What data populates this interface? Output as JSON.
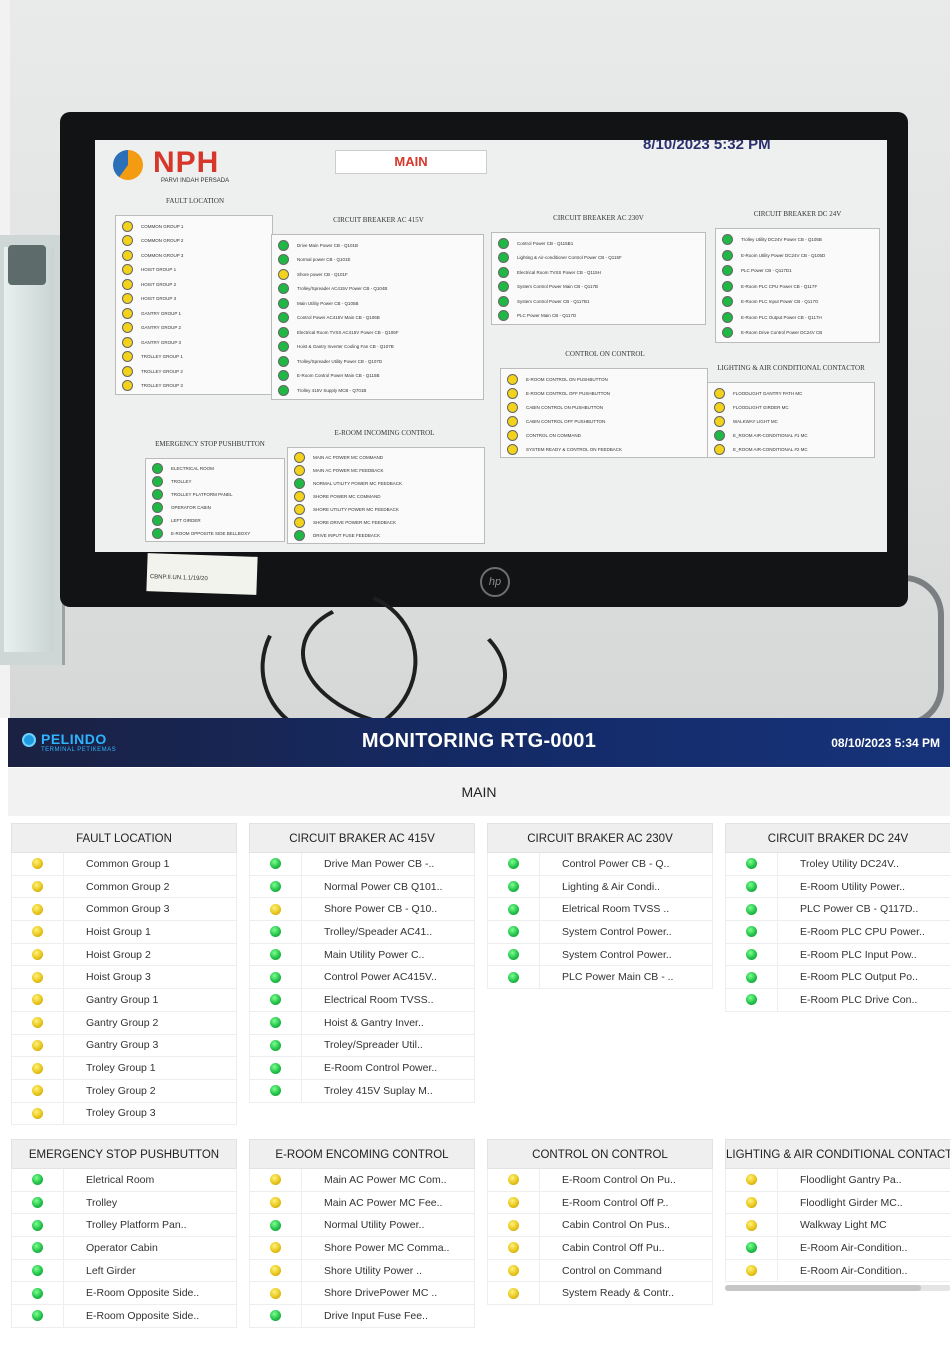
{
  "photo": {
    "screen": {
      "logo_text": "NPH",
      "logo_sub": "PARVI INDAH PERSADA",
      "main_label": "MAIN",
      "datetime": "8/10/2023 5:32 PM",
      "sections": [
        {
          "title": "FAULT LOCATION",
          "items": [
            {
              "status": "yellow",
              "label": "COMMON GROUP 1"
            },
            {
              "status": "yellow",
              "label": "COMMON GROUP 2"
            },
            {
              "status": "yellow",
              "label": "COMMON GROUP 3"
            },
            {
              "status": "yellow",
              "label": "HOIST GROUP 1"
            },
            {
              "status": "yellow",
              "label": "HOIST GROUP 2"
            },
            {
              "status": "yellow",
              "label": "HOIST GROUP 3"
            },
            {
              "status": "yellow",
              "label": "GANTRY GROUP 1"
            },
            {
              "status": "yellow",
              "label": "GANTRY GROUP 2"
            },
            {
              "status": "yellow",
              "label": "GANTRY GROUP 3"
            },
            {
              "status": "yellow",
              "label": "TROLLEY GROUP 1"
            },
            {
              "status": "yellow",
              "label": "TROLLEY GROUP 2"
            },
            {
              "status": "yellow",
              "label": "TROLLEY GROUP 3"
            }
          ]
        },
        {
          "title": "CIRCUIT BREAKER AC 415V",
          "items": [
            {
              "status": "green",
              "label": "Drive Main Power CB - Q101B"
            },
            {
              "status": "green",
              "label": "Normal power CB - Q101E"
            },
            {
              "status": "yellow",
              "label": "Shore power CB - Q101F"
            },
            {
              "status": "green",
              "label": "Trolley/Spreader AC415V Power CB - Q104B"
            },
            {
              "status": "green",
              "label": "Main Utility Power CB - Q105B"
            },
            {
              "status": "green",
              "label": "Control Power AC415V Main CB - Q106B"
            },
            {
              "status": "green",
              "label": "Electrical Room TVSS AC415V Power CB - Q106F"
            },
            {
              "status": "green",
              "label": "Hoist & Gantry Inverter Cooling Fan CB - Q107B"
            },
            {
              "status": "green",
              "label": "Trolley/Spreader Utility Power CB - Q107D"
            },
            {
              "status": "green",
              "label": "E-Room Control Power Main CB - Q115B"
            },
            {
              "status": "green",
              "label": "Trolley 415V Supply MCB - Q701B"
            }
          ]
        },
        {
          "title": "CIRCUIT BREAKER AC 230V",
          "items": [
            {
              "status": "green",
              "label": "Control Power CB - Q115B1"
            },
            {
              "status": "green",
              "label": "Lighting & Air-conditioner Control Power CB - Q115F"
            },
            {
              "status": "green",
              "label": "Electrical Room TVSS Power CB - Q115H"
            },
            {
              "status": "green",
              "label": "System Control Power Main CB - Q117B"
            },
            {
              "status": "green",
              "label": "System Control Power CB - Q117B1"
            },
            {
              "status": "green",
              "label": "PLC Power Main CB - Q117D"
            }
          ]
        },
        {
          "title": "CIRCUIT BREAKER DC 24V",
          "items": [
            {
              "status": "green",
              "label": "Trolley Utility DC24V Power CB - Q105B"
            },
            {
              "status": "green",
              "label": "E-Room Utility Power DC24V CB - Q105D"
            },
            {
              "status": "green",
              "label": "PLC Power CB - Q117D1"
            },
            {
              "status": "green",
              "label": "E-Room PLC CPU Power CB - Q117F"
            },
            {
              "status": "green",
              "label": "E-Room PLC Input Power CB - Q117G"
            },
            {
              "status": "green",
              "label": "E-Room PLC Output Power CB - Q117H"
            },
            {
              "status": "green",
              "label": "E-Room Drive Control Power DC24V CB"
            }
          ]
        },
        {
          "title": "EMERGENCY STOP PUSHBUTTON",
          "items": [
            {
              "status": "green",
              "label": "ELECTRICAL ROOM"
            },
            {
              "status": "green",
              "label": "TROLLEY"
            },
            {
              "status": "green",
              "label": "TROLLEY PLATFORM PANEL"
            },
            {
              "status": "green",
              "label": "OPERATOR CABIN"
            },
            {
              "status": "green",
              "label": "LEFT GIRDER"
            },
            {
              "status": "green",
              "label": "E-ROOM OPPOSITE SIDE BELLBOXY"
            }
          ]
        },
        {
          "title": "E-ROOM INCOMING CONTROL",
          "items": [
            {
              "status": "yellow",
              "label": "MAIN AC POWER MC COMMAND"
            },
            {
              "status": "yellow",
              "label": "MAIN AC POWER MC FEEDBACK"
            },
            {
              "status": "green",
              "label": "NORMAL UTILITY POWER MC FEEDBACK"
            },
            {
              "status": "yellow",
              "label": "SHORE POWER MC COMMAND"
            },
            {
              "status": "yellow",
              "label": "SHORE UTILITY POWER MC FEEDBACK"
            },
            {
              "status": "yellow",
              "label": "SHORE DRIVE POWER MC FEEDBACK"
            },
            {
              "status": "green",
              "label": "DRIVE INPUT FUSE FEEDBACK"
            }
          ]
        },
        {
          "title": "CONTROL ON CONTROL",
          "items": [
            {
              "status": "yellow",
              "label": "E-ROOM CONTROL ON PUSHBUTTON"
            },
            {
              "status": "yellow",
              "label": "E-ROOM CONTROL OFF PUSHBUTTON"
            },
            {
              "status": "yellow",
              "label": "CABIN CONTROL ON PUSHBUTTON"
            },
            {
              "status": "yellow",
              "label": "CABIN CONTROL OFF PUSHBUTTON"
            },
            {
              "status": "yellow",
              "label": "CONTROL ON COMMAND"
            },
            {
              "status": "yellow",
              "label": "SYSTEM READY & CONTROL ON FEEDBACK"
            }
          ]
        },
        {
          "title": "LIGHTING & AIR CONDITIONAL CONTACTOR",
          "items": [
            {
              "status": "yellow",
              "label": "FLOODLIGHT GANTRY PATH MC"
            },
            {
              "status": "yellow",
              "label": "FLOODLIGHT GIRDER MC"
            },
            {
              "status": "yellow",
              "label": "WALKWAY LIGHT MC"
            },
            {
              "status": "green",
              "label": "E_ROOM AIR-CONDITIONAL #1 MC"
            },
            {
              "status": "yellow",
              "label": "E_ROOM AIR-CONDITIONAL #2 MC"
            }
          ]
        }
      ]
    },
    "sticker_text": "CBNP.II.UN.1.1/19/20"
  },
  "app": {
    "brand": {
      "name": "PELINDO",
      "sub": "TERMINAL PETIKEMAS"
    },
    "title": "MONITORING RTG-0001",
    "datetime": "08/10/2023 5:34 PM",
    "section_title": "MAIN",
    "status_colors": {
      "yellow": "#e8c51b",
      "green": "#22c24a"
    },
    "panels": [
      {
        "title": "FAULT LOCATION",
        "items": [
          {
            "status": "yellow",
            "label": "Common Group 1"
          },
          {
            "status": "yellow",
            "label": "Common Group 2"
          },
          {
            "status": "yellow",
            "label": "Common Group 3"
          },
          {
            "status": "yellow",
            "label": "Hoist Group 1"
          },
          {
            "status": "yellow",
            "label": "Hoist Group 2"
          },
          {
            "status": "yellow",
            "label": "Hoist Group 3"
          },
          {
            "status": "yellow",
            "label": "Gantry Group 1"
          },
          {
            "status": "yellow",
            "label": "Gantry Group 2"
          },
          {
            "status": "yellow",
            "label": "Gantry Group 3"
          },
          {
            "status": "yellow",
            "label": "Troley Group 1"
          },
          {
            "status": "yellow",
            "label": "Troley Group 2"
          },
          {
            "status": "yellow",
            "label": "Troley Group 3"
          }
        ]
      },
      {
        "title": "CIRCUIT BRAKER AC 415V",
        "items": [
          {
            "status": "green",
            "label": "Drive Man Power CB -.."
          },
          {
            "status": "green",
            "label": "Normal Power CB Q101.."
          },
          {
            "status": "yellow",
            "label": "Shore Power CB - Q10.."
          },
          {
            "status": "green",
            "label": "Trolley/Speader AC41.."
          },
          {
            "status": "green",
            "label": "Main Utility Power C.."
          },
          {
            "status": "green",
            "label": "Control Power AC415V.."
          },
          {
            "status": "green",
            "label": "Electrical Room TVSS.."
          },
          {
            "status": "green",
            "label": "Hoist & Gantry Inver.."
          },
          {
            "status": "green",
            "label": "Troley/Spreader Util.."
          },
          {
            "status": "green",
            "label": "E-Room Control Power.."
          },
          {
            "status": "green",
            "label": "Troley 415V Suplay M.."
          }
        ]
      },
      {
        "title": "CIRCUIT BRAKER AC 230V",
        "items": [
          {
            "status": "green",
            "label": "Control Power CB - Q.."
          },
          {
            "status": "green",
            "label": "Lighting & Air Condi.."
          },
          {
            "status": "green",
            "label": "Eletrical Room TVSS .."
          },
          {
            "status": "green",
            "label": "System Control Power.."
          },
          {
            "status": "green",
            "label": "System Control Power.."
          },
          {
            "status": "green",
            "label": "PLC Power Main CB - .."
          }
        ]
      },
      {
        "title": "CIRCUIT BRAKER DC 24V",
        "items": [
          {
            "status": "green",
            "label": "Troley Utility DC24V.."
          },
          {
            "status": "green",
            "label": "E-Room Utility Power.."
          },
          {
            "status": "green",
            "label": "PLC Power CB - Q117D.."
          },
          {
            "status": "green",
            "label": "E-Room PLC CPU Power.."
          },
          {
            "status": "green",
            "label": "E-Room PLC Input Pow.."
          },
          {
            "status": "green",
            "label": "E-Room PLC Output Po.."
          },
          {
            "status": "green",
            "label": "E-Room PLC Drive Con.."
          }
        ]
      },
      {
        "title": "EMERGENCY STOP PUSHBUTTON",
        "items": [
          {
            "status": "green",
            "label": "Eletrical Room"
          },
          {
            "status": "green",
            "label": "Trolley"
          },
          {
            "status": "green",
            "label": "Trolley Platform Pan.."
          },
          {
            "status": "green",
            "label": "Operator Cabin"
          },
          {
            "status": "green",
            "label": "Left Girder"
          },
          {
            "status": "green",
            "label": "E-Room Opposite Side.."
          },
          {
            "status": "green",
            "label": "E-Room Opposite Side.."
          }
        ]
      },
      {
        "title": "E-ROOM ENCOMING CONTROL",
        "items": [
          {
            "status": "yellow",
            "label": "Main AC Power MC Com.."
          },
          {
            "status": "yellow",
            "label": "Main AC Power MC Fee.."
          },
          {
            "status": "green",
            "label": "Normal Utility Power.."
          },
          {
            "status": "yellow",
            "label": "Shore Power MC Comma.."
          },
          {
            "status": "yellow",
            "label": "Shore Utility Power .."
          },
          {
            "status": "yellow",
            "label": "Shore DrivePower MC .."
          },
          {
            "status": "green",
            "label": "Drive Input Fuse Fee.."
          }
        ]
      },
      {
        "title": "CONTROL ON CONTROL",
        "items": [
          {
            "status": "yellow",
            "label": "E-Room Control On Pu.."
          },
          {
            "status": "yellow",
            "label": "E-Room Control Off P.."
          },
          {
            "status": "yellow",
            "label": "Cabin Control On Pus.."
          },
          {
            "status": "yellow",
            "label": "Cabin Control Off Pu.."
          },
          {
            "status": "yellow",
            "label": "Control on Command"
          },
          {
            "status": "yellow",
            "label": "System Ready & Contr.."
          }
        ]
      },
      {
        "title": "LIGHTING & AIR CONDITIONAL CONTACTOR",
        "items": [
          {
            "status": "yellow",
            "label": "Floodlight Gantry Pa.."
          },
          {
            "status": "yellow",
            "label": "Floodlight Girder MC.."
          },
          {
            "status": "yellow",
            "label": "Walkway Light MC"
          },
          {
            "status": "green",
            "label": "E-Room Air-Condition.."
          },
          {
            "status": "yellow",
            "label": "E-Room Air-Condition.."
          }
        ]
      }
    ]
  }
}
